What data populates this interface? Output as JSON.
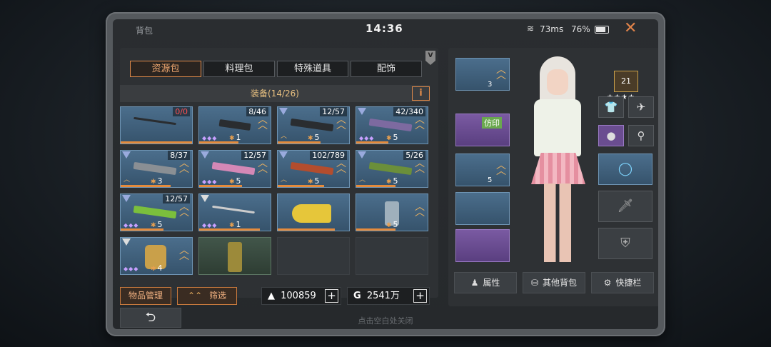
{
  "status": {
    "title": "背包",
    "time": "14:36",
    "ping": "73ms",
    "battery": "76%",
    "close_icon": "✕"
  },
  "tabs": [
    {
      "label": "资源包",
      "active": true
    },
    {
      "label": "料理包",
      "active": false
    },
    {
      "label": "特殊道具",
      "active": false
    },
    {
      "label": "配饰",
      "active": false
    }
  ],
  "version_badge": "V",
  "equip_header": {
    "label": "装备(14/26)",
    "info_label": "i"
  },
  "slots": [
    {
      "count": "0/0",
      "count_red": true,
      "lvl": ""
    },
    {
      "count": "8/46",
      "lvl": "1"
    },
    {
      "count": "12/57",
      "lvl": "5"
    },
    {
      "count": "42/340",
      "lvl": "5"
    },
    {
      "count": "8/37",
      "lvl": "3"
    },
    {
      "count": "12/57",
      "lvl": "5"
    },
    {
      "count": "102/789",
      "lvl": "5"
    },
    {
      "count": "5/26",
      "lvl": "5"
    },
    {
      "count": "12/57",
      "lvl": "5"
    },
    {
      "count": "",
      "lvl": "1"
    },
    {
      "count": "",
      "lvl": ""
    },
    {
      "count": "",
      "lvl": "5"
    },
    {
      "count": "",
      "lvl": "4"
    },
    {
      "count": "",
      "lvl": ""
    }
  ],
  "actions": {
    "manage": "物品管理",
    "filter": "筛选",
    "filter_icon": "⌃⌃",
    "currency1": "100859",
    "currency1_icon": "▲",
    "currency2": "2541万",
    "currency2_icon": "G",
    "plus": "+"
  },
  "right": {
    "helmet_lvl": "3",
    "imitation_tag": "仿印",
    "armor_lvl": "5",
    "level": "21",
    "stars": "★★★★"
  },
  "right_buttons": {
    "attributes": "属性",
    "other_bags": "其他背包",
    "shortcut": "快捷栏"
  },
  "footer": {
    "back_icon": "⮌",
    "close_hint": "点击空白处关闭"
  }
}
